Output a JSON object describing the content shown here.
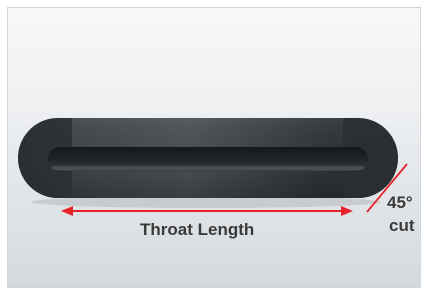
{
  "diagram": {
    "throat_label": "Throat Length",
    "cut_angle_label": "45°",
    "cut_word_label": "cut",
    "colors": {
      "dimension_arrow": "#e8232a",
      "cut_line": "#e8232a",
      "body_dark": "#2c3236",
      "body_mid": "#474e53",
      "slot_dark": "#1b1f22"
    }
  }
}
